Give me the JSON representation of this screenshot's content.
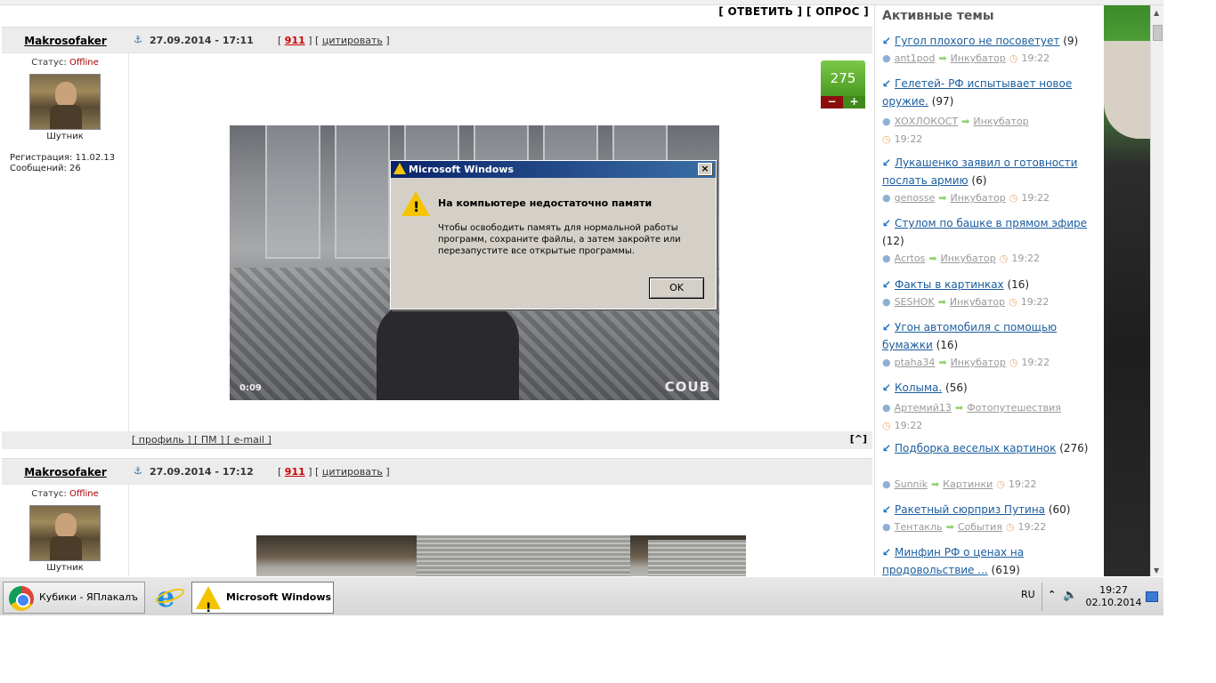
{
  "forum": {
    "reply_label": "[ ОТВЕТИТЬ ] [ ОПРОС ]",
    "posts": [
      {
        "author": "Makrosofaker",
        "date": "27.09.2014 - 17:11",
        "actions_prefix": "[ ",
        "actions_num": "911",
        "actions_mid": " ] [ ",
        "actions_quote": "цитировать",
        "actions_suffix": " ]",
        "status_label": "Статус: ",
        "status_value": "Offline",
        "rank": "Шутник",
        "registration": "Регистрация: 11.02.13",
        "messages": "Сообщений: 26",
        "rating": "275",
        "rating_minus": "−",
        "rating_plus": "+",
        "video_time": "0:09",
        "video_brand": "COUB",
        "foot_links": "[ профиль ] [ ПМ ] [ e-mail ]",
        "foot_up": "[^]"
      },
      {
        "author": "Makrosofaker",
        "date": "27.09.2014 - 17:12",
        "actions_prefix": "[ ",
        "actions_num": "911",
        "actions_mid": " ] [ ",
        "actions_quote": "цитировать",
        "actions_suffix": " ]",
        "status_label": "Статус: ",
        "status_value": "Offline",
        "rank": "Шутник"
      }
    ]
  },
  "sidebar": {
    "title": "Активные темы",
    "topics": [
      {
        "title": "Гугол плохого не посоветует",
        "count": " (9)",
        "user": "ant1pod",
        "section": "Инкубатор",
        "time": "19:22"
      },
      {
        "title": "Гелетей- РФ испытывает новое оружие.",
        "count": " (97)",
        "user": "ХОХЛОКОСТ",
        "section": "Инкубатор",
        "time": "19:22"
      },
      {
        "title": "Лукашенко заявил о готовности послать армию",
        "count": " (6)",
        "user": "genosse",
        "section": "Инкубатор",
        "time": "19:22"
      },
      {
        "title": "Стулом по башке в прямом эфире",
        "count": " (12)",
        "user": "Acrtos",
        "section": "Инкубатор",
        "time": "19:22"
      },
      {
        "title": "Факты в картинках",
        "count": " (16)",
        "user": "SESHOK",
        "section": "Инкубатор",
        "time": "19:22"
      },
      {
        "title": "Угон автомобиля с помощью бумажки",
        "count": " (16)",
        "user": "ptaha34",
        "section": "Инкубатор",
        "time": "19:22"
      },
      {
        "title": "Колыма.",
        "count": " (56)",
        "user": "Артемий13",
        "section": "Фотопутешествия",
        "time": "19:22"
      },
      {
        "title": "Подборка веселых картинок",
        "count": " (276)",
        "user": "Sunnik",
        "section": "Картинки",
        "time": "19:22"
      },
      {
        "title": "Ракетный сюрприз Путина",
        "count": " (60)",
        "user": "Тентакль",
        "section": "События",
        "time": "19:22"
      },
      {
        "title": "Минфин РФ о ценах на продовольствие ...",
        "count": " (619)"
      }
    ]
  },
  "dialog": {
    "title": "Microsoft Windows",
    "close": "×",
    "heading": "На компьютере недостаточно памяти",
    "message": "Чтобы освободить память для нормальной работы программ, сохраните файлы, а затем закройте или перезапустите все открытые программы.",
    "ok": "OK"
  },
  "taskbar": {
    "chrome_label": "Кубики - ЯПлакалъ ...",
    "active_label": "Microsoft Windows",
    "lang": "RU",
    "time": "19:27",
    "date": "02.10.2014"
  },
  "colors": {
    "link": "#1b5d9e",
    "offline": "#aa0000",
    "rating_green": "#4b9a22",
    "dialog_title": "#0a246a"
  }
}
